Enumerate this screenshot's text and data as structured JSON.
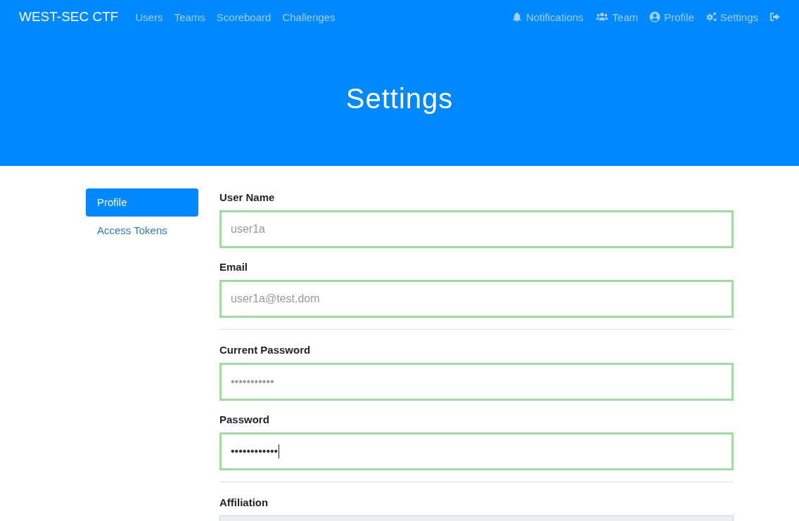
{
  "navbar": {
    "brand": "WEST-SEC CTF",
    "links": [
      {
        "label": "Users"
      },
      {
        "label": "Teams"
      },
      {
        "label": "Scoreboard"
      },
      {
        "label": "Challenges"
      }
    ],
    "right_links": [
      {
        "label": "Notifications"
      },
      {
        "label": "Team"
      },
      {
        "label": "Profile"
      },
      {
        "label": "Settings"
      },
      {
        "kind": "logout"
      }
    ]
  },
  "header": {
    "title": "Settings"
  },
  "sidebar": {
    "items": [
      {
        "label": "Profile",
        "selected": true
      },
      {
        "label": "Access Tokens",
        "selected": false
      }
    ]
  },
  "form": {
    "groups": [
      {
        "kind": "field",
        "label": "User Name",
        "placeholder": "user1a",
        "valid": true
      },
      {
        "kind": "field",
        "label": "Email",
        "placeholder": "user1a@test.dom",
        "valid": true
      },
      {
        "kind": "divider"
      },
      {
        "kind": "field",
        "label": "Current Password",
        "placeholder": "•••••••••••",
        "valid": true
      },
      {
        "kind": "field",
        "label": "Password",
        "value": "••••••••••••",
        "valid": true,
        "focused": true
      },
      {
        "kind": "divider"
      },
      {
        "kind": "field",
        "label": "Affiliation",
        "valid": false,
        "disabled": true
      }
    ]
  }
}
